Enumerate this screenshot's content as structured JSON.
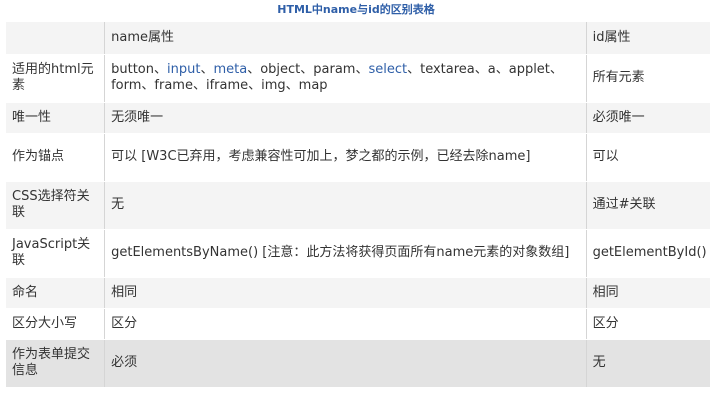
{
  "title": "HTML中name与id的区别表格",
  "header": {
    "col0": "",
    "col1": "name属性",
    "col2": "id属性"
  },
  "rows": [
    {
      "label": "适用的html元素",
      "name_parts": {
        "p0": "button、",
        "p1": "input",
        "p2": "、",
        "p3": "meta",
        "p4": "、object、param、",
        "p5": "select",
        "p6": "、textarea、a、applet、form、frame、iframe、img、map"
      },
      "id": "所有元素"
    },
    {
      "label": "唯一性",
      "name": "无须唯一",
      "id": "必须唯一"
    },
    {
      "label": "作为锚点",
      "name": "可以 [W3C已弃用，考虑兼容性可加上，梦之都的示例，已经去除name]",
      "id": "可以"
    },
    {
      "label": "CSS选择符关联",
      "name": "无",
      "id": "通过#关联"
    },
    {
      "label": "JavaScript关联",
      "name": "getElementsByName() [注意：此方法将获得页面所有name元素的对象数组]",
      "id": "getElementById()"
    },
    {
      "label": "命名",
      "name": "相同",
      "id": "相同"
    },
    {
      "label": "区分大小写",
      "name": "区分",
      "id": "区分"
    },
    {
      "label": "作为表单提交信息",
      "name": "必须",
      "id": "无"
    }
  ],
  "colors": {
    "title": "#2f5fa8",
    "link": "#2f5fa8",
    "row_alt": "#f4f4f4",
    "row_last": "#e3e3e3"
  }
}
